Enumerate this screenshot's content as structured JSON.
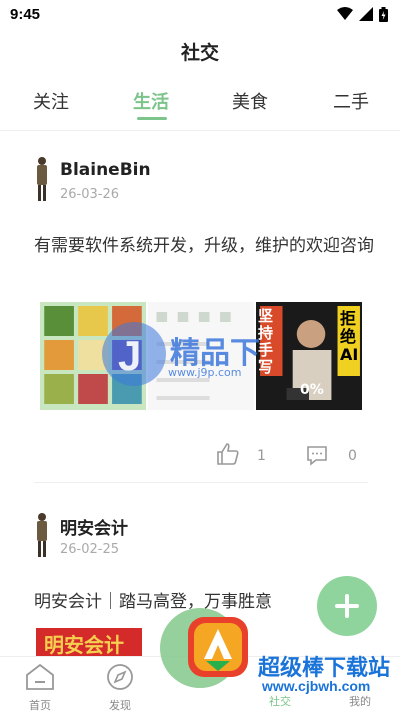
{
  "status": {
    "time": "9:45"
  },
  "header": {
    "title": "社交"
  },
  "tabs": [
    {
      "label": "关注"
    },
    {
      "label": "生活"
    },
    {
      "label": "美食"
    },
    {
      "label": "二手"
    }
  ],
  "posts": [
    {
      "author": "BlaineBin",
      "date": "26-03-26",
      "content": "有需要软件系统开发，升级，维护的欢迎咨询",
      "likes": "1",
      "comments": "0"
    },
    {
      "author": "明安会计",
      "date": "26-02-25",
      "content": "明安会计｜踏马高登，万事胜意"
    }
  ],
  "image_text": {
    "stamp1": "坚持手写",
    "stamp2": "拒绝AI",
    "stamp3": "0%",
    "stamp4": "明安会计"
  },
  "bottom_nav": [
    {
      "label": "首页"
    },
    {
      "label": "发现"
    },
    {
      "label": "社交"
    },
    {
      "label": "我的"
    }
  ],
  "watermarks": {
    "inner_text": "精品下",
    "inner_url": "www.j9p.com",
    "brand_text": "超级棒下载站",
    "brand_url": "www.cjbwh.com"
  },
  "colors": {
    "accent": "#7cc48a",
    "fab": "#8fd49c",
    "watermark_blue": "#1a73d9"
  }
}
